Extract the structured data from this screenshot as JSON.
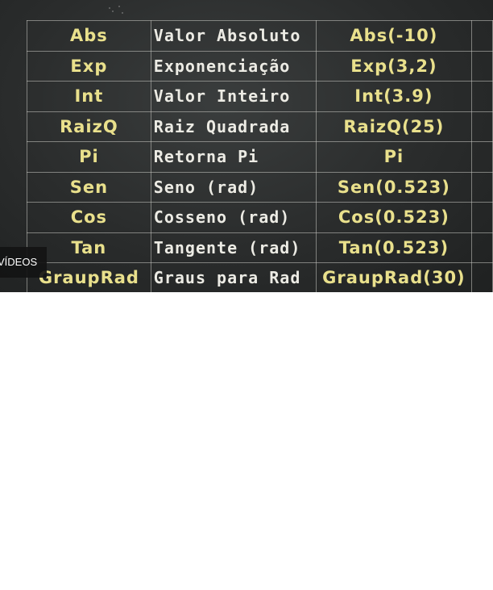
{
  "rows": [
    {
      "fn": "Abs",
      "desc": "Valor Absoluto",
      "example": "Abs(-10)"
    },
    {
      "fn": "Exp",
      "desc": "Exponenciação",
      "example": "Exp(3,2)"
    },
    {
      "fn": "Int",
      "desc": "Valor Inteiro",
      "example": "Int(3.9)"
    },
    {
      "fn": "RaizQ",
      "desc": "Raiz Quadrada",
      "example": "RaizQ(25)"
    },
    {
      "fn": "Pi",
      "desc": "Retorna Pi",
      "example": "Pi"
    },
    {
      "fn": "Sen",
      "desc": "Seno (rad)",
      "example": "Sen(0.523)"
    },
    {
      "fn": "Cos",
      "desc": "Cosseno (rad)",
      "example": "Cos(0.523)"
    },
    {
      "fn": "Tan",
      "desc": "Tangente (rad)",
      "example": "Tan(0.523)"
    },
    {
      "fn": "GraupRad",
      "desc": "Graus para Rad",
      "example": "GraupRad(30)"
    }
  ],
  "overlay": {
    "videos_label": "VÍDEOS"
  },
  "colors": {
    "chalkboard": "#2a2c2c",
    "chalk_yellow": "#e9e08c",
    "chalk_white": "#ecebe4",
    "page_background": "#ffffff"
  }
}
